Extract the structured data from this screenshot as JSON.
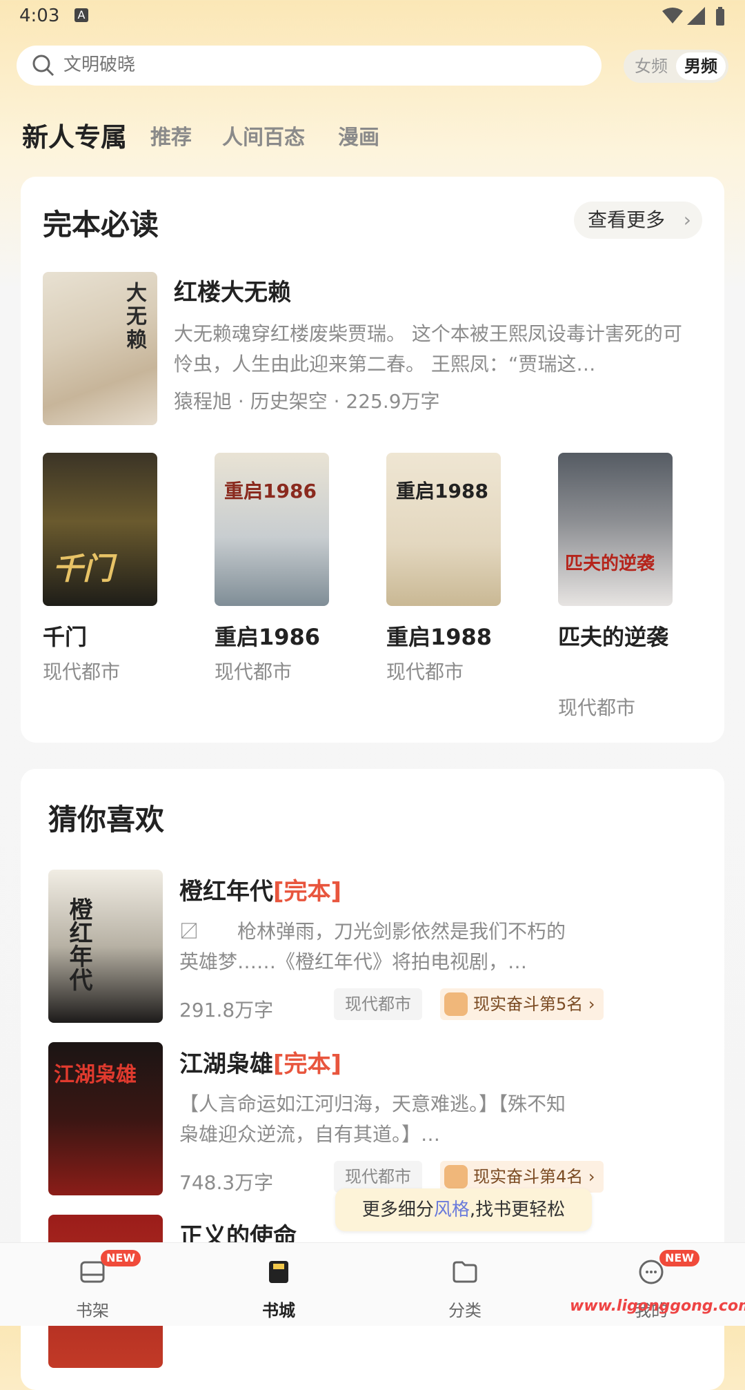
{
  "status_bar": {
    "time": "4:03",
    "notification_icon": "A"
  },
  "search": {
    "placeholder": "文明破晓"
  },
  "gender_toggle": {
    "female": "女频",
    "male": "男频",
    "selected": "男频"
  },
  "tabs": [
    "新人专属",
    "推荐",
    "人间百态",
    "漫画"
  ],
  "section_complete": {
    "title": "完本必读",
    "see_more": "查看更多",
    "featured": {
      "title": "红楼大无赖",
      "description": "大无赖魂穿红楼废柴贾瑞。 这个本被王熙凤设毒计害死的可怜虫，人生由此迎来第二春。 王熙凤：“贾瑞这…",
      "meta": "猿程旭 · 历史架空 · 225.9万字",
      "cover_text": "大无赖"
    },
    "grid": [
      {
        "title": "千门",
        "category": "现代都市",
        "cover_text": "千门"
      },
      {
        "title": "重启1986",
        "category": "现代都市",
        "cover_text": "重启1986"
      },
      {
        "title": "重启1988",
        "category": "现代都市",
        "cover_text": "重启1988"
      },
      {
        "title": "匹夫的逆袭",
        "category": "现代都市",
        "cover_text": "匹夫的逆袭"
      }
    ]
  },
  "section_guess": {
    "title": "猜你喜欢",
    "items": [
      {
        "title": "橙红年代",
        "tag": "[完本]",
        "description": "〼　　枪林弹雨，刀光剑影依然是我们不朽的英雄梦……《橙红年代》将拍电视剧，…",
        "words": "291.8万字",
        "category": "现代都市",
        "rank": "现实奋斗第5名",
        "cover_text": "橙红年代"
      },
      {
        "title": "江湖枭雄",
        "tag": "[完本]",
        "description": "【人言命运如江河归海，天意难逃。】【殊不知枭雄迎众逆流，自有其道。】…",
        "words": "748.3万字",
        "category": "现代都市",
        "rank": "现实奋斗第4名",
        "cover_text": "江湖枭雄"
      },
      {
        "title": "正义的使命",
        "tag": "",
        "description": "",
        "words": "",
        "category": "",
        "rank": "",
        "cover_text": ""
      }
    ]
  },
  "tooltip": {
    "prefix": "更多细分",
    "highlight": "风格",
    "suffix": ",找书更轻松"
  },
  "bottom_nav": [
    {
      "label": "书架",
      "badge": "NEW",
      "icon": "bookshelf-icon"
    },
    {
      "label": "书城",
      "badge": "",
      "icon": "bookstore-icon"
    },
    {
      "label": "分类",
      "badge": "",
      "icon": "folder-icon"
    },
    {
      "label": "我的",
      "badge": "NEW",
      "icon": "profile-chat-icon"
    }
  ],
  "watermark": "www.ligonggong.com"
}
